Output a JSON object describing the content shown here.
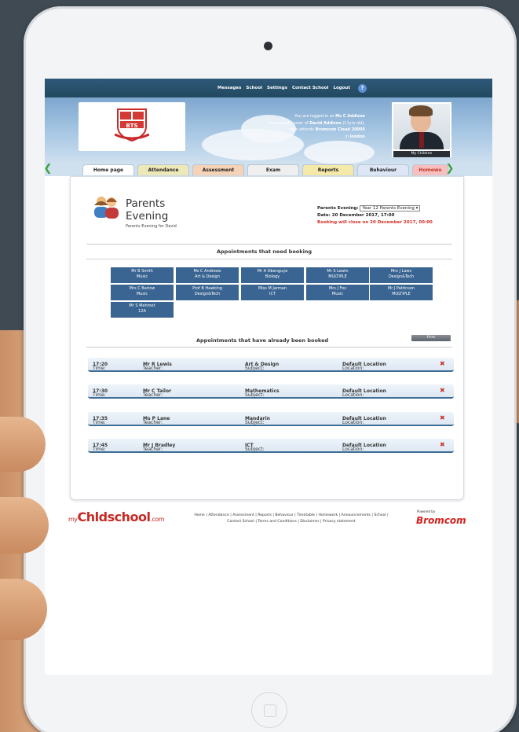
{
  "topnav": {
    "links": [
      "Messages",
      "School",
      "Settings",
      "Contact School",
      "Logout"
    ]
  },
  "header": {
    "school_logo_text": "BTS",
    "logged_in_line1_prefix": "You are logged in as",
    "logged_in_name": "Ms C Addison",
    "logged_in_line2_prefix": "the parent / carer of",
    "child_name": "David Addison",
    "child_age": "(11yrs old),",
    "logged_in_line3_prefix": "who attends",
    "school_name": "Bromcom Cloud 20005",
    "logged_in_line4_prefix": "in",
    "house": "london",
    "my_children_label": "My Children"
  },
  "tabs": [
    "Home page",
    "Attendance",
    "Assessment",
    "Exam",
    "Reports",
    "Behaviour",
    "Homewo"
  ],
  "tab_colors": [
    "#ffffff",
    "#ede8b8",
    "#f6d3b7",
    "#efefef",
    "#f4e9a8",
    "#dde6f5",
    "#f7c0bf"
  ],
  "page": {
    "title": "Parents Evening",
    "subtitle": "Parents Evening for David",
    "evening_label": "Parents Evening:",
    "evening_value": "Year 12 Parents Evening ▾",
    "date_label": "Date: 20 December 2017, 17:00",
    "booking_close": "Booking will close on 20 December 2017, 00:00"
  },
  "need_booking": {
    "title": "Appointments that need booking",
    "items": [
      {
        "teacher": "Mr B Smith",
        "subject": "Music"
      },
      {
        "teacher": "Ms C Andrews",
        "subject": "Art & Design"
      },
      {
        "teacher": "Mr A Obenguye",
        "subject": "Biology"
      },
      {
        "teacher": "Mr S Lewin",
        "subject": "MULTIPLE"
      },
      {
        "teacher": "Mrs J Laws",
        "subject": "Design&Tech"
      },
      {
        "teacher": "Mrs C Barlow",
        "subject": "Music"
      },
      {
        "teacher": "Prof B Hawking",
        "subject": "Design&Tech"
      },
      {
        "teacher": "Miss M Jarman",
        "subject": "ICT"
      },
      {
        "teacher": "Mrs J Fox",
        "subject": "Music"
      },
      {
        "teacher": "Mr J Pattinson",
        "subject": "MULTIPLE"
      },
      {
        "teacher": "Mr S Mehmet",
        "subject": "12A"
      }
    ]
  },
  "booked": {
    "title": "Appointments that have already been booked",
    "print_label": "Print",
    "time_label": "Time:",
    "teacher_label": "Teacher:",
    "subject_label": "Subject:",
    "location_label": "Location:",
    "rows": [
      {
        "time": "17:20",
        "teacher": "Mr R Lewis",
        "subject": "Art & Design",
        "location": "Default Location"
      },
      {
        "time": "17:30",
        "teacher": "Mr C Tailor",
        "subject": "Mathematics",
        "location": "Default Location"
      },
      {
        "time": "17:35",
        "teacher": "Ms P Lane",
        "subject": "Mandarin",
        "location": "Default Location"
      },
      {
        "time": "17:45",
        "teacher": "Mr J Bradley",
        "subject": "ICT",
        "location": "Default Location"
      }
    ]
  },
  "footer": {
    "logo_main": "Ch",
    "logo_mid": "ldschool",
    "logo_suffix": ".com",
    "logo_my": "my",
    "links_line1": "Home | Attendance | Assessment | Reports | Behaviour | Timetable | Homework | Announcements | School |",
    "links_line2": "Contact School | Terms and Conditions | Disclaimer | Privacy statement",
    "powered_by": "Powered by",
    "brand": "Bromcom"
  }
}
